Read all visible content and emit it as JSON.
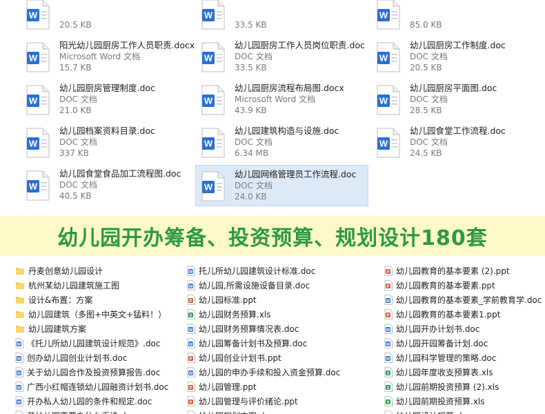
{
  "grid": {
    "tiles": [
      {
        "name": "",
        "type": "",
        "size": "20.5 KB",
        "icon": "word-icon",
        "col": 0,
        "row": -1
      },
      {
        "name": "",
        "type": "",
        "size": "33.5 KB",
        "icon": "word-icon",
        "col": 1,
        "row": -1
      },
      {
        "name": "",
        "type": "",
        "size": "85.0 KB",
        "icon": "word-icon",
        "col": 2,
        "row": -1
      },
      {
        "name": "阳光幼儿园厨房工作人员职责.docx",
        "type": "Microsoft Word 文档",
        "size": "15.7 KB",
        "icon": "word-icon",
        "col": 0,
        "row": 0
      },
      {
        "name": "幼儿园厨房工作人员岗位职责.doc",
        "type": "DOC 文档",
        "size": "33.5 KB",
        "icon": "word-icon",
        "col": 1,
        "row": 0
      },
      {
        "name": "幼儿园厨房工作制度.doc",
        "type": "DOC 文档",
        "size": "20.5 KB",
        "icon": "word-icon",
        "col": 2,
        "row": 0
      },
      {
        "name": "幼儿园厨房管理制度.doc",
        "type": "DOC 文档",
        "size": "21.0 KB",
        "icon": "word-icon",
        "col": 0,
        "row": 1
      },
      {
        "name": "幼儿园厨房流程布局图.docx",
        "type": "Microsoft Word 文档",
        "size": "43.9 KB",
        "icon": "word-icon",
        "col": 1,
        "row": 1
      },
      {
        "name": "幼儿园厨房平面图.doc",
        "type": "DOC 文档",
        "size": "28.5 KB",
        "icon": "word-icon",
        "col": 2,
        "row": 1
      },
      {
        "name": "幼儿园档案资料目录.doc",
        "type": "DOC 文档",
        "size": "337 KB",
        "icon": "word-icon",
        "col": 0,
        "row": 2
      },
      {
        "name": "幼儿园建筑构造与设施.doc",
        "type": "DOC 文档",
        "size": "6.34 MB",
        "icon": "word-icon",
        "col": 1,
        "row": 2
      },
      {
        "name": "幼儿园食堂工作流程.doc",
        "type": "DOC 文档",
        "size": "24.5 KB",
        "icon": "word-icon",
        "col": 2,
        "row": 2
      },
      {
        "name": "幼儿园食堂食品加工流程图.doc",
        "type": "DOC 文档",
        "size": "40.5 KB",
        "icon": "word-icon",
        "col": 0,
        "row": 3
      },
      {
        "name": "幼儿园网络管理员工作流程.doc",
        "type": "DOC 文档",
        "size": "24.0 KB",
        "icon": "word-icon",
        "col": 1,
        "row": 3,
        "selected": true
      }
    ]
  },
  "banner": {
    "title": "幼儿园开办筹备、投资预算、规划设计180套"
  },
  "list": {
    "columns": [
      [
        {
          "name": "丹麦创意幼儿园设计",
          "icon": "folder-icon"
        },
        {
          "name": "杭州某幼儿园建筑施工图",
          "icon": "folder-icon"
        },
        {
          "name": "设计&布置：方案",
          "icon": "folder-icon"
        },
        {
          "name": "幼儿园建筑（多图+中英文+猛料！）",
          "icon": "folder-icon"
        },
        {
          "name": "幼儿园建筑方案",
          "icon": "folder-icon"
        },
        {
          "name": "《托儿所幼儿园建筑设计规范》.doc",
          "icon": "doc-icon"
        },
        {
          "name": "创办幼儿园创业计划书.doc",
          "icon": "doc-icon"
        },
        {
          "name": "关于幼儿园合作及投资预算报告.doc",
          "icon": "doc-icon"
        },
        {
          "name": "广西小红帽连锁幼儿园融资计划书.doc",
          "icon": "doc-icon"
        },
        {
          "name": "开办私人幼儿园的条件和规定.doc",
          "icon": "doc-icon"
        },
        {
          "name": "开幼儿园需要办什么手续.doc",
          "icon": "doc-icon"
        }
      ],
      [
        {
          "name": "托儿所幼儿园建筑设计标准.doc",
          "icon": "doc-icon"
        },
        {
          "name": "幼儿园,所需设施设备目录.doc",
          "icon": "doc-icon"
        },
        {
          "name": "幼儿园标准.ppt",
          "icon": "ppt-icon"
        },
        {
          "name": "幼儿园财务预算.xls",
          "icon": "xls-icon"
        },
        {
          "name": "幼儿园财务预算情况表.doc",
          "icon": "doc-icon"
        },
        {
          "name": "幼儿园筹备计划书及预算.doc",
          "icon": "doc-icon"
        },
        {
          "name": "幼儿园创业计划书.ppt",
          "icon": "ppt-icon"
        },
        {
          "name": "幼儿园的申办手续和投入资金预算.doc",
          "icon": "doc-icon"
        },
        {
          "name": "幼儿园管理.ppt",
          "icon": "ppt-icon"
        },
        {
          "name": "幼儿园管理与评价绪论.ppt",
          "icon": "ppt-icon"
        },
        {
          "name": "幼儿园规划方案.doc",
          "icon": "doc-icon"
        }
      ],
      [
        {
          "name": "幼儿园教育的基本要素 (2).ppt",
          "icon": "ppt-icon"
        },
        {
          "name": "幼儿园教育的基本要素.ppt",
          "icon": "ppt-icon"
        },
        {
          "name": "幼儿园教育的基本要素_学前教育学.doc",
          "icon": "doc-icon"
        },
        {
          "name": "幼儿园教育的基本要素1.ppt",
          "icon": "ppt-icon"
        },
        {
          "name": "幼儿园开办计划书.doc",
          "icon": "doc-icon"
        },
        {
          "name": "幼儿园开园筹备计划.doc",
          "icon": "doc-icon"
        },
        {
          "name": "幼儿园科学管理的策略.doc",
          "icon": "doc-icon"
        },
        {
          "name": "幼儿园年度收支预算表.xls",
          "icon": "xls-icon"
        },
        {
          "name": "幼儿园前期投资预算 (2).xls",
          "icon": "xls-icon"
        },
        {
          "name": "幼儿园前期投资预算.xls",
          "icon": "xls-icon"
        },
        {
          "name": "幼儿园设计规范.doc",
          "icon": "doc-icon"
        }
      ]
    ]
  },
  "colors": {
    "word_blue": "#2b6fd6",
    "folder": "#f3c84d",
    "ppt": "#d55b33",
    "xls": "#2f9c4f",
    "banner_bg": "#fdf9c8",
    "banner_text": "#2c9a41",
    "selection": "#dce9f7"
  }
}
